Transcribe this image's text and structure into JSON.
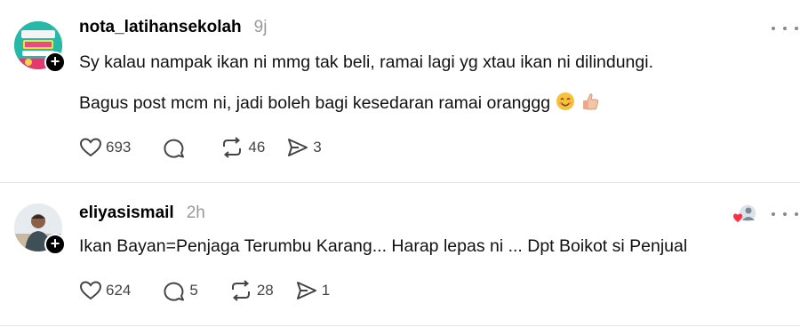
{
  "posts": [
    {
      "username": "nota_latihansekolah",
      "time": "9j",
      "lines": [
        "Sy kalau nampak ikan ni mmg tak beli, ramai lagi yg xtau ikan ni dilindungi.",
        "Bagus post mcm ni, jadi boleh bagi kesedaran ramai oranggg"
      ],
      "emojis": [
        "smiling-face-icon",
        "thumbs-up-icon"
      ],
      "stats": {
        "likes": "693",
        "replies": "",
        "reposts": "46",
        "shares": "3"
      },
      "avatar_icon": "school-logo-avatar"
    },
    {
      "username": "eliyasismail",
      "time": "2h",
      "lines": [
        "Ikan Bayan=Penjaga Terumbu Karang... Harap lepas ni ... Dpt Boikot si Penjual"
      ],
      "stats": {
        "likes": "624",
        "replies": "5",
        "reposts": "28",
        "shares": "1"
      },
      "avatar_icon": "person-avatar",
      "liked_by_icon": "heart-liker-icon"
    }
  ],
  "colors": {
    "text": "#111111",
    "muted": "#999999",
    "icon": "#444444",
    "divider": "#e5e5e5",
    "heart": "#ff3040"
  }
}
